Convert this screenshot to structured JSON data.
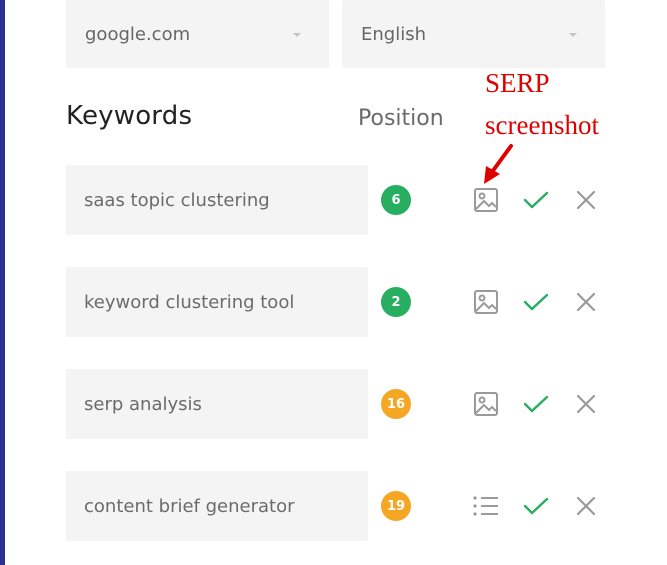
{
  "filters": {
    "search_engine": {
      "value": "google.com",
      "icon": "chevron-down-icon"
    },
    "language": {
      "value": "English",
      "icon": "chevron-down-icon"
    }
  },
  "headers": {
    "keywords": "Keywords",
    "position": "Position"
  },
  "annotation": {
    "line1": "SERP",
    "line2": "screenshot",
    "color": "#e00000"
  },
  "colors": {
    "badge_green": "#27ae60",
    "badge_orange": "#f5a623",
    "check_green": "#27ae60",
    "icon_gray": "#9a9a9a",
    "border_blue": "#2b2f8f"
  },
  "keywords": [
    {
      "text": "saas topic clustering",
      "position": "6",
      "badge_color": "green",
      "action_icon": "image-icon"
    },
    {
      "text": "keyword clustering tool",
      "position": "2",
      "badge_color": "green",
      "action_icon": "image-icon"
    },
    {
      "text": "serp analysis",
      "position": "16",
      "badge_color": "orange",
      "action_icon": "image-icon"
    },
    {
      "text": "content brief generator",
      "position": "19",
      "badge_color": "orange",
      "action_icon": "list-icon"
    }
  ]
}
